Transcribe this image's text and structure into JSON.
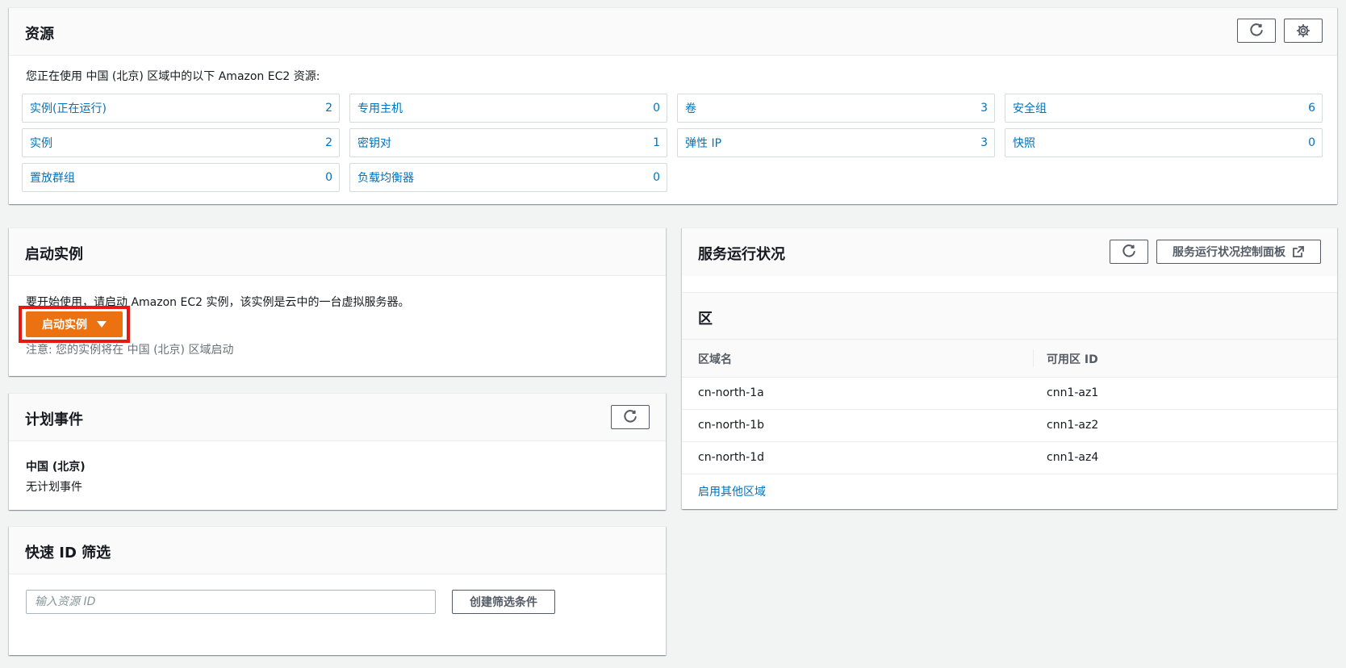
{
  "resources": {
    "title": "资源",
    "description": "您正在使用 中国 (北京) 区域中的以下 Amazon EC2 资源:",
    "items": [
      {
        "label": "实例(正在运行)",
        "count": "2"
      },
      {
        "label": "专用主机",
        "count": "0"
      },
      {
        "label": "卷",
        "count": "3"
      },
      {
        "label": "安全组",
        "count": "6"
      },
      {
        "label": "实例",
        "count": "2"
      },
      {
        "label": "密钥对",
        "count": "1"
      },
      {
        "label": "弹性 IP",
        "count": "3"
      },
      {
        "label": "快照",
        "count": "0"
      },
      {
        "label": "置放群组",
        "count": "0"
      },
      {
        "label": "负载均衡器",
        "count": "0"
      }
    ]
  },
  "launch": {
    "title": "启动实例",
    "description": "要开始使用，请启动 Amazon EC2 实例，该实例是云中的一台虚拟服务器。",
    "button_label": "启动实例",
    "note": "注意: 您的实例将在 中国 (北京) 区域启动"
  },
  "scheduled_events": {
    "title": "计划事件",
    "region": "中国 (北京)",
    "status": "无计划事件"
  },
  "quick_filter": {
    "title": "快速 ID 筛选",
    "placeholder": "输入资源 ID",
    "button_label": "创建筛选条件"
  },
  "service_health": {
    "title": "服务运行状况",
    "dashboard_button": "服务运行状况控制面板",
    "zones_title": "区",
    "col_zone_name": "区域名",
    "col_zone_id": "可用区 ID",
    "zones": [
      {
        "name": "cn-north-1a",
        "id": "cnn1-az1"
      },
      {
        "name": "cn-north-1b",
        "id": "cnn1-az2"
      },
      {
        "name": "cn-north-1d",
        "id": "cnn1-az4"
      }
    ],
    "enable_link": "启用其他区域"
  },
  "colors": {
    "accent": "#ec7211",
    "link": "#0073bb",
    "highlight": "#e8170f"
  },
  "icons": [
    "refresh-icon",
    "gear-icon",
    "external-link-icon",
    "caret-down-icon"
  ]
}
